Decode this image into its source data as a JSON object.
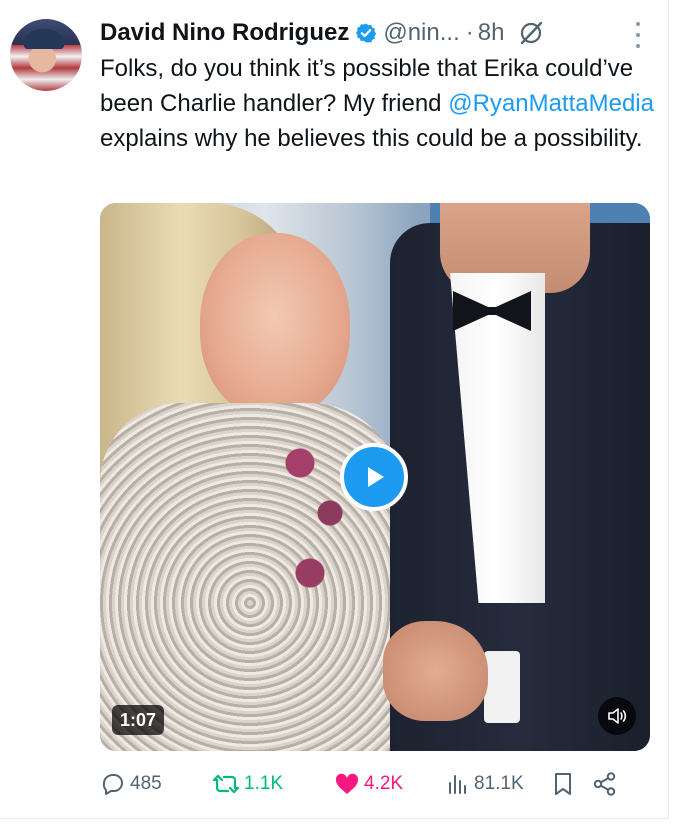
{
  "author": {
    "name": "David Nino Rodriguez",
    "handle": "@nin...",
    "separator": "·",
    "time": "8h"
  },
  "icons": {
    "verified": "verified-badge-icon",
    "grok": "grok-icon",
    "more": "more-options-icon"
  },
  "tweet": {
    "text_before": "Folks, do you think it’s possible that Erika could’ve been Charlie handler? My friend ",
    "mention": "@RyanMattaMedia",
    "text_after": " explains why he believes this could be a possibility."
  },
  "media": {
    "duration": "1:07"
  },
  "actions": {
    "replies": "485",
    "reposts": "1.1K",
    "likes": "4.2K",
    "views": "81.1K"
  },
  "colors": {
    "accent": "#1d9bf0",
    "repost": "#00ba7c",
    "like": "#f91880",
    "muted": "#536471"
  }
}
